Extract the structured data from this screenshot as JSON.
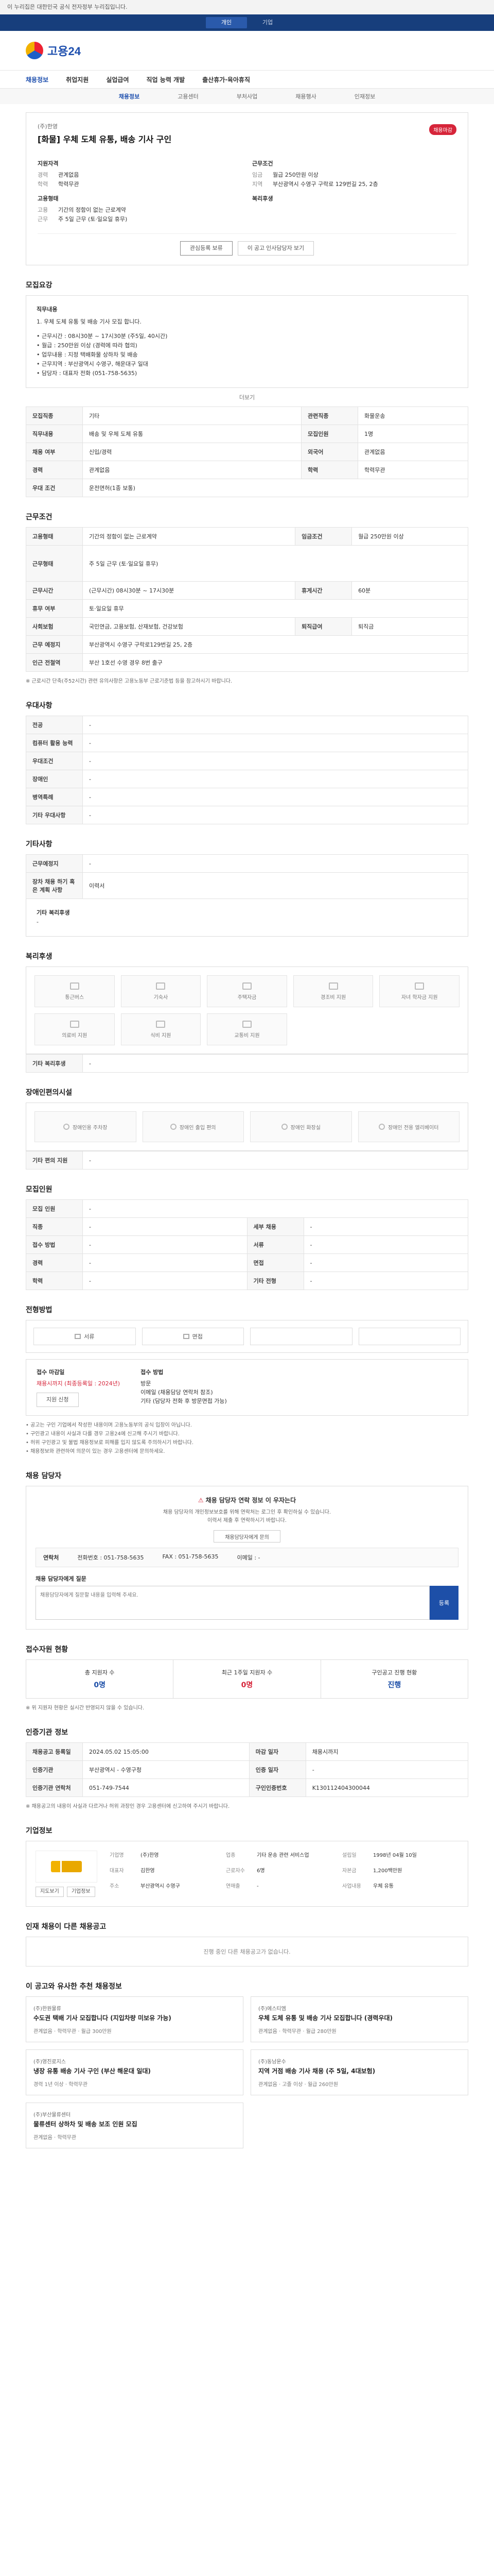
{
  "gov_bar": "이 누리집은 대한민국 공식 전자정부 누리집입니다.",
  "util_tabs": [
    "개인",
    "기업"
  ],
  "logo": "고용24",
  "gnb": [
    "채용정보",
    "취업지원",
    "실업급여",
    "직업 능력 개발",
    "출산휴가·육아휴직"
  ],
  "lnb": [
    "채용정보",
    "고용센터",
    "부처사업",
    "채용행사",
    "인재정보"
  ],
  "job": {
    "company": "(주)한영",
    "title": "[화물] 우체 도체 유통, 배송 기사 구인",
    "badge": "채용마감",
    "summary_left_h": "지원자격",
    "summary_left": [
      {
        "k": "경력",
        "v": "관계없음"
      },
      {
        "k": "학력",
        "v": "학력무관"
      }
    ],
    "summary_left_h2": "고용형태",
    "summary_left2": [
      {
        "k": "고용",
        "v": "기간의 정함이 없는 근로계약"
      },
      {
        "k": "근무",
        "v": "주 5일 근무 (토·일요일 휴무)"
      }
    ],
    "summary_right_h": "근무조건",
    "summary_right": [
      {
        "k": "임금",
        "v": "월급 250만원 이상"
      },
      {
        "k": "지역",
        "v": "부산광역시 수영구 구락로 129번길 25, 2층"
      }
    ],
    "summary_right_h2": "복리후생",
    "btn_apply": "관심등록 보류",
    "btn_share": "이 공고 인사담당자 보기"
  },
  "sections": {
    "recruit": "모집요강",
    "conditions": "근무조건",
    "preference": "우대사항",
    "other": "기타사항",
    "benefits": "복리후생",
    "disabled": "장애인편의시설",
    "recruit_info": "모집인원",
    "method": "전형방법",
    "manager": "채용 담당자",
    "status": "접수자원 현황",
    "intro": "인증기관 정보",
    "company": "기업정보",
    "same_co": "인재 채용이 다른 채용공고",
    "recommend": "이 공고와 유사한 추천 채용정보"
  },
  "content": {
    "head": "직무내용",
    "lines": [
      "1. 우체 도체 유통 및 배송 기사 모집 합니다.",
      "",
      "• 근무시간 : 08시30분 ~ 17시30분 (주5일, 40시간)",
      "• 월급 : 250만원 이상 (경력에 따라 협의)",
      "• 업무내용 : 지정 택배화물 상하차 및 배송",
      "• 근무지역 : 부산광역시 수영구, 해운대구 일대",
      "• 담당자 : 대표자 전화 (051-758-5635)"
    ],
    "more": "더보기"
  },
  "recruit_table": [
    [
      "모집직종",
      "기타",
      "관련직종",
      "화물운송"
    ],
    [
      "직무내용",
      "배송 및 우체 도체 유통",
      "모집인원",
      "1명"
    ],
    [
      "채용 여부",
      "신입/경력",
      "외국어",
      "관계없음"
    ],
    [
      "경력",
      "관계없음",
      "학력",
      "학력무관"
    ],
    [
      "우대 조건",
      "운전면허(1종 보통)",
      "",
      ""
    ]
  ],
  "work_table": [
    [
      "고용형태",
      "기간의 정함이 없는 근로계약",
      "임금조건",
      "월급 250만원 이상"
    ],
    [
      "근무형태",
      "주 5일 근무 (토·일요일 휴무)",
      "",
      ""
    ],
    [
      "근무시간",
      "(근무시간) 08시30분 ~ 17시30분",
      "휴게시간",
      "60분"
    ],
    [
      "휴무 여부",
      "토·일요일 휴무",
      "",
      ""
    ],
    [
      "사회보험",
      "국민연금, 고용보험, 산재보험, 건강보험",
      "퇴직급여",
      "퇴직금"
    ],
    [
      "근무 예정지",
      "부산광역시 수영구 구락로129번길 25, 2층",
      "",
      ""
    ],
    [
      "인근 전철역",
      "부산 1호선 수영 경우 8번 출구",
      "",
      ""
    ]
  ],
  "work_note": "※ 근로시간 단축(주52시간) 관련 유의사항은 고용노동부 근로기준법 등을 참고하시기 바랍니다.",
  "pref_table": [
    [
      "전공",
      "-"
    ],
    [
      "컴퓨터 활용 능력",
      "-"
    ],
    [
      "우대조건",
      "-"
    ],
    [
      "장애인",
      "-"
    ],
    [
      "병역특례",
      "-"
    ],
    [
      "기타 우대사항",
      "-"
    ]
  ],
  "other_table": [
    [
      "근무예정지",
      "-"
    ],
    [
      "장차 채용 하기 혹은 계획 사항",
      "이력서"
    ]
  ],
  "other_extra_label": "기타 복리후생",
  "other_extra_val": "-",
  "benefits": [
    "통근버스",
    "기숙사",
    "주택자금",
    "경조비 지원",
    "자녀 학자금 지원",
    "의료비 지원",
    "식비 지원",
    "교통비 지원"
  ],
  "benefits_etc_label": "기타 복리후생",
  "benefits_etc_val": "-",
  "disabled": [
    "장애인용 주차장",
    "장애인 출입 편의",
    "장애인 화장실",
    "장애인 전용 엘리베이터"
  ],
  "disabled_etc_label": "기타 편의 지원",
  "disabled_etc_val": "-",
  "recruit_info_table": [
    [
      "모집 인원",
      "-",
      "",
      ""
    ],
    [
      "직종",
      "-",
      "세부 채용",
      "-"
    ],
    [
      "접수 방법",
      "-",
      "서류",
      "-"
    ],
    [
      "경력",
      "-",
      "면접",
      "-"
    ],
    [
      "학력",
      "-",
      "기타 전형",
      "-"
    ]
  ],
  "methods": [
    "서류",
    "면접"
  ],
  "apply": {
    "period_label": "접수 마감일",
    "period": "채용시까지 (최종등록일 : 2024년)",
    "method_label": "접수 방법",
    "method": "방문\n이메일 (채용담당 연락처 참조)\n기타 (담당자 전화 후 방문면접 가능)",
    "btn": "지원 신청"
  },
  "notes": [
    "공고는 구인 기업에서 작성한 내용이며 고용노동부의 공식 입장이 아닙니다.",
    "구인광고 내용이 사실과 다를 경우 고용24에 신고해 주시기 바랍니다.",
    "허위 구인광고 및 불법 채용정보로 피해를 입지 않도록 주의하시기 바랍니다.",
    "채용정보와 관련하여 의문이 있는 경우 고용센터에 문의하세요."
  ],
  "manager": {
    "warn": "채용 담당자 연락 정보 이 우자는다",
    "warn_text": "채용 담당자의 개인정보보호를 위해 연락처는 로그인 후 확인하실 수 있습니다.\n이력서 제출 후 연락하시기 바랍니다.",
    "warn_btn": "채용담당자에게 문의",
    "contact_label": "연락처",
    "tel": "전화번호 : 051-758-5635",
    "fax": "FAX : 051-758-5635",
    "email": "이메일 : -",
    "qa_label": "채용 담당자에게 질문",
    "qa_placeholder": "채용담당자에게 질문할 내용을 입력해 주세요.",
    "qa_btn": "등록"
  },
  "status": [
    {
      "label": "총 지원자 수",
      "val": "0명"
    },
    {
      "label": "최근 1주일 지원자 수",
      "val": "0명"
    },
    {
      "label": "구인공고 진행 현황",
      "val": "진행"
    }
  ],
  "status_note": "※ 위 지원자 현황은 실시간 반영되지 않을 수 있습니다.",
  "intro_table": [
    [
      "채용공고 등록일",
      "2024.05.02 15:05:00",
      "마감 일자",
      "채용시까지"
    ],
    [
      "인증기관",
      "부산광역시 - 수영구청",
      "인증 일자",
      "-"
    ],
    [
      "인증기관 연락처",
      "051-749-7544",
      "구인인증번호",
      "K130112404300044"
    ]
  ],
  "intro_note": "※ 채용공고의 내용이 사실과 다르거나 허위 과장인 경우 고용센터에 신고하여 주시기 바랍니다.",
  "company": {
    "items": [
      [
        "기업명",
        "(주)한영",
        "업종",
        "기타 운송 관련 서비스업",
        "설립일",
        "1998년 04월 10일"
      ],
      [
        "대표자",
        "김한영",
        "근로자수",
        "6명",
        "자본금",
        "1,200백만원"
      ],
      [
        "주소",
        "부산광역시 수영구",
        "연매출",
        "-",
        "사업내용",
        "우체 유통"
      ]
    ],
    "btns": [
      "지도보기",
      "기업정보"
    ]
  },
  "same_co_empty": "진행 중인 다른 채용공고가 없습니다.",
  "recommend": [
    {
      "co": "(주)한원물류",
      "title": "수도권 택배 기사 모집합니다 (지입차량 미보유 가능)",
      "meta": "관계없음 · 학력무관 · 월급 300만원"
    },
    {
      "co": "(주)에스티엠",
      "title": "우체 도체 유통 및 배송 기사 모집합니다 (경력우대)",
      "meta": "관계없음 · 학력무관 · 월급 280만원"
    },
    {
      "co": "(주)영진로지스",
      "title": "냉장 유통 배송 기사 구인 (부산 해운대 일대)",
      "meta": "경력 1년 이상 · 학력무관"
    },
    {
      "co": "(주)동남운수",
      "title": "지역 거점 배송 기사 채용 (주 5일, 4대보험)",
      "meta": "관계없음 · 고졸 이상 · 월급 260만원"
    },
    {
      "co": "(주)부산물류센터",
      "title": "물류센터 상하차 및 배송 보조 인원 모집",
      "meta": "관계없음 · 학력무관"
    }
  ]
}
